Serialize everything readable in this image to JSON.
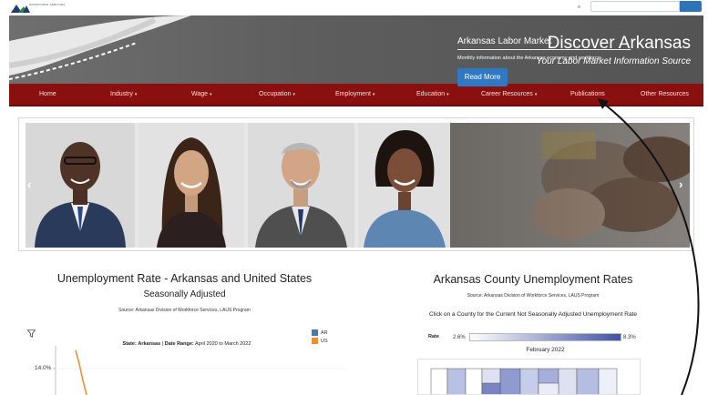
{
  "header": {
    "site_title": "Discover Arkansas",
    "tagline": "Your Labor Market Information Source"
  },
  "nav": {
    "items": [
      {
        "label": "Home",
        "dropdown": false
      },
      {
        "label": "Industry",
        "dropdown": true
      },
      {
        "label": "Wage",
        "dropdown": true
      },
      {
        "label": "Occupation",
        "dropdown": true
      },
      {
        "label": "Employment",
        "dropdown": true
      },
      {
        "label": "Education",
        "dropdown": true
      },
      {
        "label": "Career Resources",
        "dropdown": true
      },
      {
        "label": "Publications",
        "dropdown": false
      },
      {
        "label": "Other Resources",
        "dropdown": false
      }
    ],
    "caret": "▾"
  },
  "carousel": {
    "caption_title": "Arkansas Labor Market",
    "caption_text": "Monthly information about the Arkansas economy and workforce",
    "button_label": "Read More",
    "prev_icon": "‹",
    "next_icon": "›"
  },
  "unemployment_chart": {
    "title": "Unemployment Rate - Arkansas and United States",
    "subtitle": "Seasonally Adjusted",
    "source": "Source: Arkansas Division of Workforce Services, LAUS Program",
    "filter_state_label": "State:",
    "filter_state_value": "Arkansas",
    "filter_range_label": "Date Range:",
    "filter_range_value": "April 2020 to March 2022",
    "legend": [
      {
        "name": "AR",
        "color": "#4e79a7"
      },
      {
        "name": "US",
        "color": "#f28e2b"
      }
    ],
    "y_tick": "14.0%"
  },
  "county_map": {
    "title": "Arkansas County Unemployment Rates",
    "source": "Source: Arkansas Division of Workforce Services, LAUS Program",
    "instruction": "Click on a County for the Current Not Seasonally Adjusted Unemployment Rate",
    "rate_label": "Rate",
    "rate_min": "2.6%",
    "rate_max": "8.3%",
    "month": "February 2022"
  },
  "colors": {
    "nav_bg": "#8a1010",
    "banner_bg": "#5d5d5d",
    "button_blue": "#2f78c4",
    "scale_low": "#ffffff",
    "scale_high": "#4052a8"
  },
  "chart_data": {
    "type": "line",
    "title": "Unemployment Rate - Arkansas and United States",
    "subtitle": "Seasonally Adjusted",
    "series": [
      {
        "name": "US",
        "values": [
          14.0
        ]
      },
      {
        "name": "AR"
      }
    ],
    "x": [
      "Apr 2020"
    ],
    "ylabel": "",
    "y_ticks": [
      "14.0%"
    ],
    "legend_placement": "top-right"
  }
}
